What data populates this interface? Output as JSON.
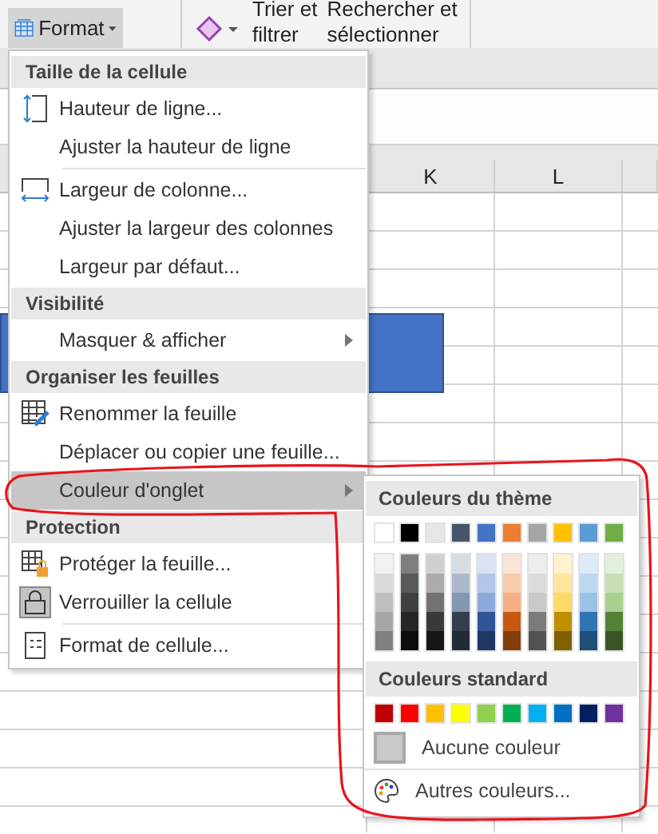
{
  "ribbon": {
    "format_button": {
      "label": "Format",
      "selected": true
    },
    "sort_filter": {
      "line_1": "Trier et",
      "line_2": "filtrer"
    },
    "find_select": {
      "line_1": "Rechercher et",
      "line_2": "sélectionner"
    }
  },
  "sheet": {
    "columns": [
      {
        "label": "K"
      },
      {
        "label": "L"
      }
    ]
  },
  "format_menu": {
    "items": [
      {
        "kind": "header",
        "label": "Taille de la cellule"
      },
      {
        "kind": "item",
        "label": "Hauteur de ligne...",
        "selected": false,
        "checked": false,
        "submenu": false,
        "divider_after": false
      },
      {
        "kind": "item",
        "label": "Ajuster la hauteur de ligne",
        "selected": false,
        "checked": false,
        "submenu": false,
        "divider_after": true
      },
      {
        "kind": "item",
        "label": "Largeur de colonne...",
        "selected": false,
        "checked": false,
        "submenu": false,
        "divider_after": false
      },
      {
        "kind": "item",
        "label": "Ajuster la largeur des colonnes",
        "selected": false,
        "checked": false,
        "submenu": false,
        "divider_after": false
      },
      {
        "kind": "item",
        "label": "Largeur par défaut...",
        "selected": false,
        "checked": false,
        "submenu": false,
        "divider_after": false
      },
      {
        "kind": "header",
        "label": "Visibilité"
      },
      {
        "kind": "item",
        "label": "Masquer & afficher",
        "selected": false,
        "checked": false,
        "submenu": true,
        "divider_after": false
      },
      {
        "kind": "header",
        "label": "Organiser les feuilles"
      },
      {
        "kind": "item",
        "label": "Renommer la feuille",
        "selected": false,
        "checked": false,
        "submenu": false,
        "divider_after": false
      },
      {
        "kind": "item",
        "label": "Déplacer ou copier une feuille...",
        "selected": false,
        "checked": false,
        "submenu": false,
        "divider_after": false
      },
      {
        "kind": "item",
        "label": "Couleur d'onglet",
        "selected": true,
        "checked": false,
        "submenu": true,
        "divider_after": false
      },
      {
        "kind": "header",
        "label": "Protection"
      },
      {
        "kind": "item",
        "label": "Protéger la feuille...",
        "selected": false,
        "checked": false,
        "submenu": false,
        "divider_after": false
      },
      {
        "kind": "item",
        "label": "Verrouiller la cellule",
        "selected": false,
        "checked": true,
        "submenu": false,
        "divider_after": true
      },
      {
        "kind": "item",
        "label": "Format de cellule...",
        "selected": false,
        "checked": false,
        "submenu": false,
        "divider_after": false
      }
    ]
  },
  "tab_color_menu": {
    "theme_header": "Couleurs du thème",
    "theme_colors": [
      {
        "color": "#ffffff",
        "shades": [
          {
            "color": "#f2f2f2"
          },
          {
            "color": "#d9d9d9"
          },
          {
            "color": "#bfbfbf"
          },
          {
            "color": "#a6a6a6"
          },
          {
            "color": "#808080"
          }
        ]
      },
      {
        "color": "#000000",
        "shades": [
          {
            "color": "#7f7f7f"
          },
          {
            "color": "#595959"
          },
          {
            "color": "#404040"
          },
          {
            "color": "#262626"
          },
          {
            "color": "#0d0d0d"
          }
        ]
      },
      {
        "color": "#e7e6e6",
        "shades": [
          {
            "color": "#d0cece"
          },
          {
            "color": "#aeaaaa"
          },
          {
            "color": "#757171"
          },
          {
            "color": "#3a3838"
          },
          {
            "color": "#171616"
          }
        ]
      },
      {
        "color": "#44546a",
        "shades": [
          {
            "color": "#d6dce4"
          },
          {
            "color": "#adb9ca"
          },
          {
            "color": "#8497b0"
          },
          {
            "color": "#333f4f"
          },
          {
            "color": "#222b35"
          }
        ]
      },
      {
        "color": "#4472c4",
        "shades": [
          {
            "color": "#d9e1f2"
          },
          {
            "color": "#b4c6e7"
          },
          {
            "color": "#8ea9db"
          },
          {
            "color": "#305496"
          },
          {
            "color": "#203764"
          }
        ]
      },
      {
        "color": "#ed7d31",
        "shades": [
          {
            "color": "#fce4d6"
          },
          {
            "color": "#f8cbad"
          },
          {
            "color": "#f4b084"
          },
          {
            "color": "#c65911"
          },
          {
            "color": "#833c0b"
          }
        ]
      },
      {
        "color": "#a5a5a5",
        "shades": [
          {
            "color": "#ededed"
          },
          {
            "color": "#dbdbdb"
          },
          {
            "color": "#c9c9c9"
          },
          {
            "color": "#7b7b7b"
          },
          {
            "color": "#525252"
          }
        ]
      },
      {
        "color": "#ffc000",
        "shades": [
          {
            "color": "#fff2cc"
          },
          {
            "color": "#ffe699"
          },
          {
            "color": "#ffd966"
          },
          {
            "color": "#bf8f00"
          },
          {
            "color": "#806000"
          }
        ]
      },
      {
        "color": "#5b9bd5",
        "shades": [
          {
            "color": "#ddebf7"
          },
          {
            "color": "#bdd7ee"
          },
          {
            "color": "#9bc2e6"
          },
          {
            "color": "#2f75b5"
          },
          {
            "color": "#1f4e78"
          }
        ]
      },
      {
        "color": "#70ad47",
        "shades": [
          {
            "color": "#e2efda"
          },
          {
            "color": "#c6e0b4"
          },
          {
            "color": "#a9d08e"
          },
          {
            "color": "#548235"
          },
          {
            "color": "#375623"
          }
        ]
      }
    ],
    "standard_header": "Couleurs standard",
    "standard_colors": [
      {
        "color": "#c00000"
      },
      {
        "color": "#ff0000"
      },
      {
        "color": "#ffc000"
      },
      {
        "color": "#ffff00"
      },
      {
        "color": "#92d050"
      },
      {
        "color": "#00b050"
      },
      {
        "color": "#00b0f0"
      },
      {
        "color": "#0070c0"
      },
      {
        "color": "#002060"
      },
      {
        "color": "#7030a0"
      }
    ],
    "no_color": "Aucune couleur",
    "more_colors": "Autres couleurs..."
  }
}
